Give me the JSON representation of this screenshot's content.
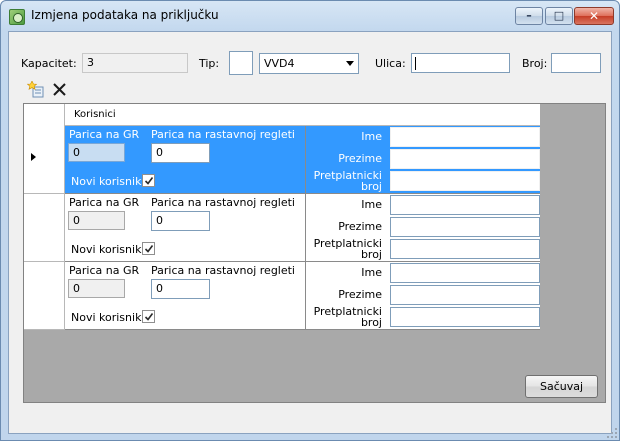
{
  "window": {
    "title": "Izmjena podataka na priključku",
    "min_glyph": "–",
    "max_glyph": "□",
    "close_glyph": "✕"
  },
  "form": {
    "kapacitet_label": "Kapacitet:",
    "kapacitet_value": "3",
    "tip_label": "Tip:",
    "tip_combo_value": "VVD4",
    "ulica_label": "Ulica:",
    "ulica_value": "",
    "broj_label": "Broj:",
    "broj_value": ""
  },
  "toolbar": {
    "add_icon": "add-row-icon",
    "delete_icon": "delete-x-icon"
  },
  "grid": {
    "column_header": "Korisnici",
    "rows": [
      {
        "selected": true,
        "parica_gr_label": "Parica na GR",
        "parica_gr_value": "0",
        "parica_rast_label": "Parica na rastavnoj regleti",
        "parica_rast_value": "0",
        "novi_korisnik_label": "Novi korisnik",
        "novi_korisnik_checked": true,
        "ime_label": "Ime",
        "prezime_label": "Prezime",
        "pretplatnicki_label_1": "Pretplatnicki",
        "pretplatnicki_label_2": "broj",
        "ime_value": "",
        "prezime_value": "",
        "broj_value": ""
      },
      {
        "selected": false,
        "parica_gr_label": "Parica na GR",
        "parica_gr_value": "0",
        "parica_rast_label": "Parica na rastavnoj regleti",
        "parica_rast_value": "0",
        "novi_korisnik_label": "Novi korisnik",
        "novi_korisnik_checked": true,
        "ime_label": "Ime",
        "prezime_label": "Prezime",
        "pretplatnicki_label_1": "Pretplatnicki",
        "pretplatnicki_label_2": "broj",
        "ime_value": "",
        "prezime_value": "",
        "broj_value": ""
      },
      {
        "selected": false,
        "parica_gr_label": "Parica na GR",
        "parica_gr_value": "0",
        "parica_rast_label": "Parica na rastavnoj regleti",
        "parica_rast_value": "0",
        "novi_korisnik_label": "Novi korisnik",
        "novi_korisnik_checked": true,
        "ime_label": "Ime",
        "prezime_label": "Prezime",
        "pretplatnicki_label_1": "Pretplatnicki",
        "pretplatnicki_label_2": "broj",
        "ime_value": "",
        "prezime_value": "",
        "broj_value": ""
      }
    ]
  },
  "footer": {
    "save_label": "Sačuvaj"
  },
  "colors": {
    "selection": "#3399ff",
    "grid_background": "#a9a9a9"
  }
}
